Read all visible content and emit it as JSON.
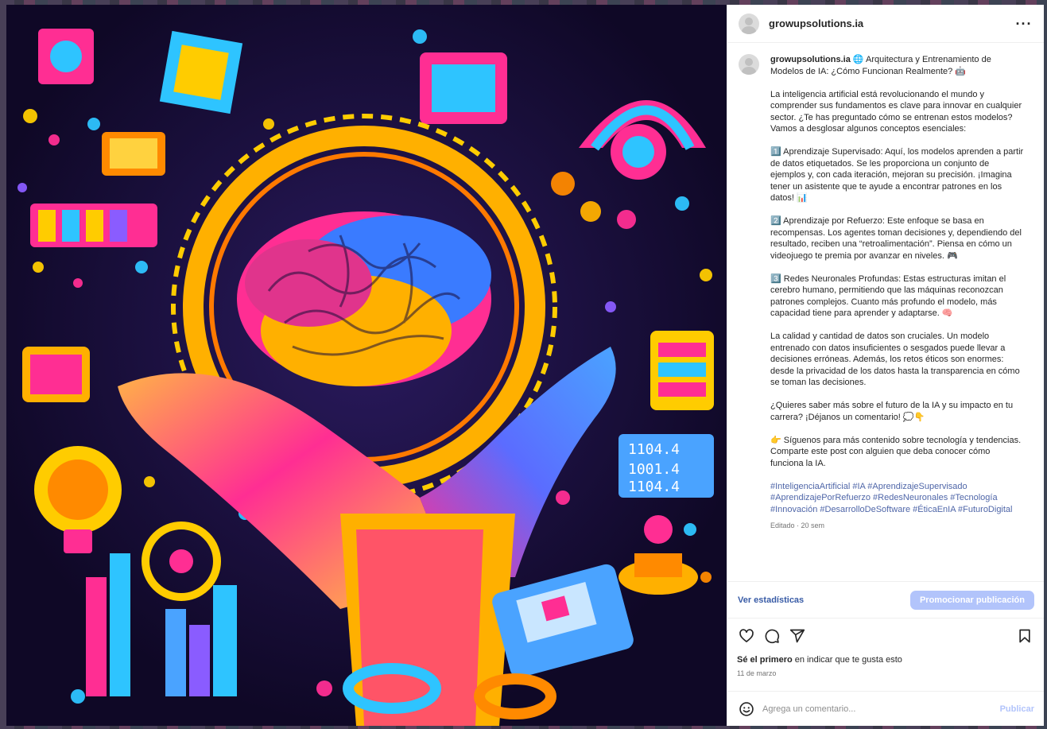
{
  "post": {
    "username": "growupsolutions.ia",
    "media_description_icon": "ai-brain-artwork",
    "caption": {
      "title": "🌐 Arquitectura y Entrenamiento de Modelos de IA: ¿Cómo Funcionan Realmente? 🤖",
      "paragraphs": [
        "La inteligencia artificial está revolucionando el mundo y comprender sus fundamentos es clave para innovar en cualquier sector. ¿Te has preguntado cómo se entrenan estos modelos? Vamos a desglosar algunos conceptos esenciales:",
        "1️⃣ Aprendizaje Supervisado: Aquí, los modelos aprenden a partir de datos etiquetados. Se les proporciona un conjunto de ejemplos y, con cada iteración, mejoran su precisión. ¡Imagina tener un asistente que te ayude a encontrar patrones en los datos! 📊",
        "2️⃣ Aprendizaje por Refuerzo: Este enfoque se basa en recompensas. Los agentes toman decisiones y, dependiendo del resultado, reciben una “retroalimentación”. Piensa en cómo un videojuego te premia por avanzar en niveles. 🎮",
        "3️⃣ Redes Neuronales Profundas: Estas estructuras imitan el cerebro humano, permitiendo que las máquinas reconozcan patrones complejos. Cuanto más profundo el modelo, más capacidad tiene para aprender y adaptarse. 🧠",
        "La calidad y cantidad de datos son cruciales. Un modelo entrenado con datos insuficientes o sesgados puede llevar a decisiones erróneas. Además, los retos éticos son enormes: desde la privacidad de los datos hasta la transparencia en cómo se toman las decisiones.",
        "¿Quieres saber más sobre el futuro de la IA y su impacto en tu carrera? ¡Déjanos un comentario! 💭👇",
        "👉 Síguenos para más contenido sobre tecnología y tendencias. Comparte este post con alguien que deba conocer cómo funciona la IA."
      ],
      "hashtags": "#InteligenciaArtificial #IA #AprendizajeSupervisado #AprendizajePorRefuerzo #RedesNeuronales #Tecnología #Innovación #DesarrolloDeSoftware #ÉticaEnIA #FuturoDigital",
      "meta": "Editado · 20 sem"
    },
    "insights": {
      "stats_link": "Ver estadísticas",
      "promote_button": "Promocionar publicación"
    },
    "likes_text_bold": "Sé el primero",
    "likes_text_rest": " en indicar que te gusta esto",
    "date": "11 de marzo",
    "comment": {
      "placeholder": "Agrega un comentario...",
      "post_button": "Publicar"
    },
    "icons": [
      "more-icon",
      "heart-icon",
      "comment-icon",
      "share-icon",
      "bookmark-icon",
      "emoji-icon"
    ],
    "colors": {
      "link": "#4f66a8",
      "promote": "#b2c4fb",
      "muted": "#737373"
    }
  }
}
